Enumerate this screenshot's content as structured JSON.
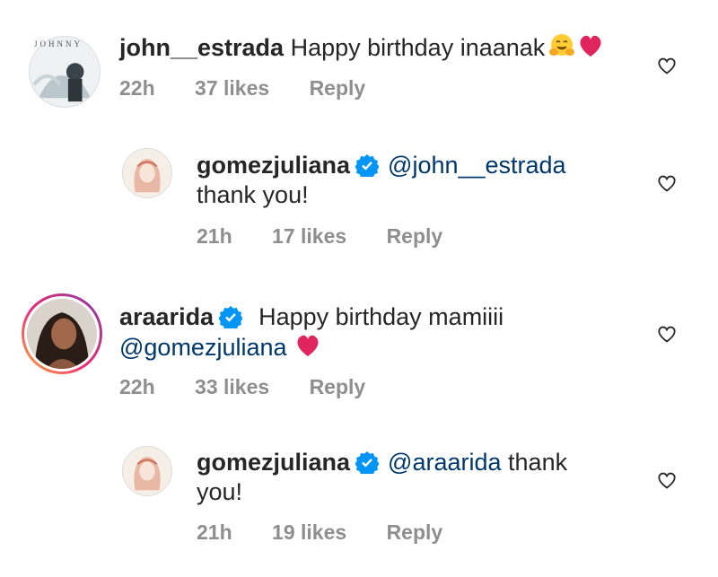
{
  "colors": {
    "text": "#262626",
    "meta": "#8e8e8e",
    "mention": "#00376b",
    "verified": "#0095f6",
    "heart_emoji": "#e0245e"
  },
  "comments": [
    {
      "username": "john__estrada",
      "verified": false,
      "text": "Happy birthday inaanak",
      "emojis": [
        "hugging-face",
        "red-heart"
      ],
      "time": "22h",
      "likes": "37 likes",
      "reply": "Reply",
      "avatar_text": "JOHNNY"
    },
    {
      "username": "gomezjuliana",
      "verified": true,
      "mention": "@john__estrada",
      "text": "thank you!",
      "time": "21h",
      "likes": "17 likes",
      "reply": "Reply"
    },
    {
      "username": "araarida",
      "verified": true,
      "text": "Happy birthday mamiiii",
      "mention": "@gomezjuliana",
      "emojis": [
        "red-heart"
      ],
      "time": "22h",
      "likes": "33 likes",
      "reply": "Reply"
    },
    {
      "username": "gomezjuliana",
      "verified": true,
      "mention": "@araarida",
      "text_inline": "thank",
      "text": "you!",
      "time": "21h",
      "likes": "19 likes",
      "reply": "Reply"
    }
  ]
}
